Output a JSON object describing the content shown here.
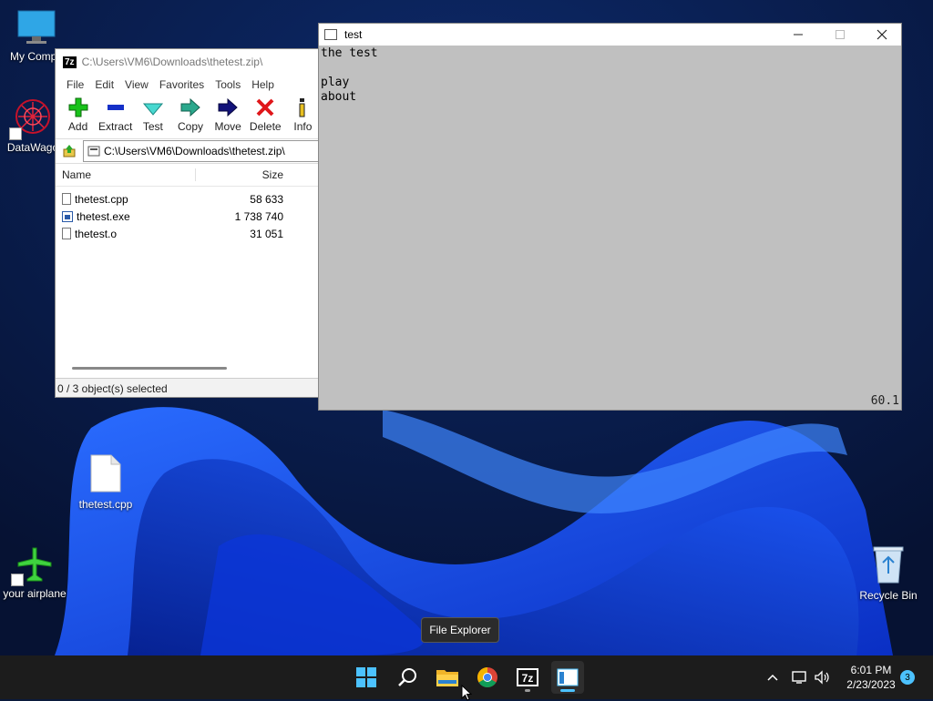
{
  "desktop": {
    "icons": [
      {
        "label": "My Compu",
        "icon": "monitor-icon"
      },
      {
        "label": "DataWago",
        "icon": "datawagon-icon"
      },
      {
        "label": "thetest.cpp",
        "icon": "file-icon"
      },
      {
        "label": "your airplane",
        "icon": "airplane-icon"
      },
      {
        "label": "Recycle Bin",
        "icon": "recycle-bin-icon"
      }
    ]
  },
  "zip_window": {
    "title": "C:\\Users\\VM6\\Downloads\\thetest.zip\\",
    "badge": "7z",
    "menu": [
      "File",
      "Edit",
      "View",
      "Favorites",
      "Tools",
      "Help"
    ],
    "toolbar": [
      "Add",
      "Extract",
      "Test",
      "Copy",
      "Move",
      "Delete",
      "Info"
    ],
    "address": "C:\\Users\\VM6\\Downloads\\thetest.zip\\",
    "columns": {
      "name": "Name",
      "size": "Size"
    },
    "files": [
      {
        "name": "thetest.cpp",
        "size": "58 633",
        "icon": "file-icon"
      },
      {
        "name": "thetest.exe",
        "size": "1 738 740",
        "icon": "exe-icon"
      },
      {
        "name": "thetest.o",
        "size": "31 051",
        "icon": "file-icon"
      }
    ],
    "status": "0 / 3 object(s) selected"
  },
  "test_window": {
    "title": "test",
    "lines": [
      "the test",
      "",
      "play",
      "about"
    ],
    "fps": "60.1"
  },
  "tooltip": "File Explorer",
  "taskbar": {
    "apps": [
      "start-icon",
      "search-icon",
      "file-explorer-icon",
      "chrome-icon",
      "7zip-icon",
      "test-app-icon"
    ],
    "time": "6:01 PM",
    "date": "2/23/2023",
    "notification_count": "3"
  },
  "colors": {
    "taskbar": "#1c1c1c",
    "accent": "#4cc2ff",
    "console_bg": "#c0c0c0"
  }
}
